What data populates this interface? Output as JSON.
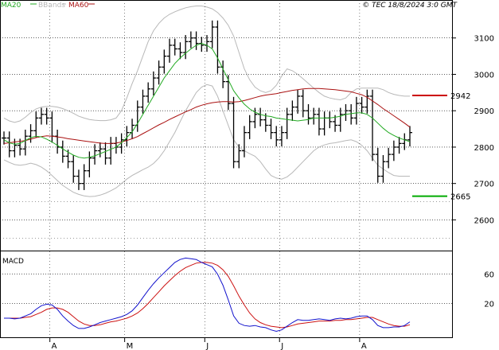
{
  "legend": {
    "ma20": "MA20",
    "bbands": "BBands",
    "ma60": "MA60"
  },
  "copyright": "© TEC 18/8/2024 3:0 GMT",
  "macd_label": "MACD",
  "colors": {
    "ma20": "#22aa22",
    "ma60": "#aa1111",
    "bbands": "#b8b8b8",
    "price": "#000000",
    "macd": "#1111cc",
    "signal": "#cc1111",
    "grid": "#000000",
    "level_high": "#cc0000",
    "level_low": "#00aa00"
  },
  "chart_data": [
    {
      "type": "line",
      "title": "",
      "ylim": [
        2520,
        3200
      ],
      "y_ticks": [
        {
          "value": 3100,
          "label": "3100"
        },
        {
          "value": 3000,
          "label": "3000"
        },
        {
          "value": 2900,
          "label": "2900"
        },
        {
          "value": 2800,
          "label": "2800"
        },
        {
          "value": 2700,
          "label": "2700"
        },
        {
          "value": 2600,
          "label": "2600"
        }
      ],
      "x_ticks": [
        "A",
        "M",
        "J",
        "J",
        "A"
      ],
      "levels": [
        {
          "name": "resistance",
          "value": 2942,
          "label": "2942"
        },
        {
          "name": "support",
          "value": 2665,
          "label": "2665"
        }
      ],
      "series": [
        {
          "name": "price",
          "values": [
            2825,
            2790,
            2805,
            2795,
            2830,
            2845,
            2880,
            2890,
            2880,
            2830,
            2800,
            2775,
            2760,
            2720,
            2700,
            2735,
            2770,
            2790,
            2795,
            2770,
            2810,
            2800,
            2820,
            2840,
            2860,
            2910,
            2940,
            2960,
            2990,
            3020,
            3050,
            3080,
            3070,
            3060,
            3090,
            3100,
            3085,
            3080,
            3090,
            3130,
            3020,
            2980,
            2920,
            2760,
            2790,
            2840,
            2870,
            2890,
            2875,
            2860,
            2840,
            2820,
            2840,
            2890,
            2910,
            2940,
            2900,
            2880,
            2890,
            2850,
            2880,
            2870,
            2860,
            2890,
            2900,
            2880,
            2920,
            2910,
            2940,
            2780,
            2720,
            2760,
            2780,
            2800,
            2810,
            2820,
            2840
          ]
        },
        {
          "name": "MA20",
          "values": [
            2820,
            2812,
            2808,
            2810,
            2818,
            2826,
            2830,
            2828,
            2822,
            2814,
            2805,
            2795,
            2786,
            2778,
            2772,
            2770,
            2772,
            2776,
            2782,
            2788,
            2794,
            2800,
            2812,
            2826,
            2842,
            2865,
            2890,
            2915,
            2940,
            2965,
            2990,
            3010,
            3030,
            3045,
            3058,
            3070,
            3080,
            3085,
            3080,
            3070,
            3045,
            3015,
            2985,
            2955,
            2935,
            2918,
            2905,
            2896,
            2890,
            2886,
            2884,
            2880,
            2878,
            2876,
            2874,
            2872,
            2874,
            2876,
            2880,
            2880,
            2880,
            2880,
            2882,
            2885,
            2890,
            2892,
            2894,
            2894,
            2890,
            2880,
            2866,
            2852,
            2840,
            2832,
            2825,
            2820,
            2815
          ]
        },
        {
          "name": "MA60",
          "values": [
            2810,
            2812,
            2814,
            2816,
            2818,
            2822,
            2826,
            2829,
            2831,
            2830,
            2828,
            2826,
            2823,
            2821,
            2819,
            2817,
            2815,
            2813,
            2811,
            2810,
            2810,
            2811,
            2814,
            2818,
            2823,
            2829,
            2837,
            2845,
            2853,
            2861,
            2868,
            2876,
            2883,
            2890,
            2897,
            2903,
            2910,
            2915,
            2919,
            2922,
            2924,
            2925,
            2925,
            2924,
            2925,
            2928,
            2932,
            2936,
            2940,
            2943,
            2945,
            2947,
            2950,
            2953,
            2956,
            2958,
            2960,
            2961,
            2961,
            2961,
            2960,
            2959,
            2958,
            2956,
            2954,
            2952,
            2948,
            2944,
            2937,
            2927,
            2917,
            2906,
            2896,
            2886,
            2876,
            2866,
            2855
          ]
        },
        {
          "name": "BBand upper",
          "values": [
            2880,
            2872,
            2868,
            2872,
            2882,
            2895,
            2905,
            2910,
            2912,
            2912,
            2910,
            2906,
            2900,
            2893,
            2885,
            2880,
            2876,
            2874,
            2873,
            2873,
            2875,
            2880,
            2900,
            2935,
            2975,
            3010,
            3050,
            3090,
            3120,
            3140,
            3155,
            3165,
            3172,
            3178,
            3183,
            3186,
            3188,
            3188,
            3185,
            3180,
            3170,
            3155,
            3135,
            3105,
            3060,
            3015,
            2985,
            2965,
            2955,
            2950,
            2955,
            2970,
            2995,
            3015,
            3010,
            3000,
            2988,
            2975,
            2962,
            2950,
            2940,
            2935,
            2932,
            2930,
            2935,
            2950,
            2960,
            2962,
            2962,
            2962,
            2962,
            2958,
            2950,
            2945,
            2942,
            2940,
            2940
          ]
        },
        {
          "name": "BBand lower",
          "values": [
            2765,
            2758,
            2752,
            2750,
            2752,
            2756,
            2752,
            2745,
            2735,
            2722,
            2708,
            2695,
            2685,
            2676,
            2670,
            2666,
            2664,
            2665,
            2668,
            2673,
            2680,
            2688,
            2700,
            2712,
            2722,
            2730,
            2738,
            2745,
            2755,
            2770,
            2790,
            2815,
            2840,
            2870,
            2900,
            2925,
            2950,
            2965,
            2972,
            2968,
            2940,
            2900,
            2860,
            2820,
            2800,
            2790,
            2782,
            2775,
            2760,
            2740,
            2722,
            2715,
            2712,
            2718,
            2730,
            2745,
            2760,
            2775,
            2790,
            2800,
            2806,
            2810,
            2812,
            2815,
            2818,
            2820,
            2815,
            2805,
            2790,
            2770,
            2750,
            2740,
            2730,
            2722,
            2720,
            2720,
            2720
          ]
        }
      ]
    },
    {
      "type": "line",
      "title": "MACD",
      "ylim": [
        -25,
        90
      ],
      "y_ticks": [
        {
          "value": 60,
          "label": "60"
        },
        {
          "value": 20,
          "label": "20"
        }
      ],
      "series": [
        {
          "name": "MACD",
          "values": [
            0,
            0,
            -1,
            0,
            3,
            6,
            12,
            17,
            19,
            18,
            12,
            3,
            -4,
            -10,
            -14,
            -14,
            -12,
            -9,
            -6,
            -4,
            -2,
            0,
            2,
            5,
            10,
            18,
            28,
            38,
            47,
            55,
            62,
            69,
            76,
            80,
            82,
            81,
            80,
            76,
            73,
            70,
            60,
            45,
            25,
            3,
            -7,
            -10,
            -11,
            -10,
            -12,
            -13,
            -16,
            -18,
            -16,
            -11,
            -6,
            -2,
            -3,
            -3,
            -2,
            -1,
            -2,
            -3,
            -1,
            0,
            -1,
            0,
            2,
            3,
            3,
            -2,
            -10,
            -13,
            -13,
            -12,
            -12,
            -10,
            -5
          ]
        },
        {
          "name": "Signal",
          "values": [
            0,
            0,
            0,
            0,
            1,
            2,
            5,
            8,
            12,
            14,
            14,
            12,
            8,
            2,
            -4,
            -8,
            -10,
            -10,
            -9,
            -7,
            -5,
            -4,
            -2,
            0,
            3,
            7,
            13,
            20,
            28,
            36,
            44,
            51,
            58,
            64,
            69,
            72,
            75,
            76,
            76,
            75,
            72,
            66,
            57,
            44,
            30,
            18,
            7,
            -1,
            -6,
            -9,
            -11,
            -12,
            -13,
            -12,
            -10,
            -8,
            -7,
            -6,
            -5,
            -4,
            -4,
            -4,
            -3,
            -3,
            -2,
            -2,
            -1,
            0,
            1,
            1,
            -2,
            -5,
            -8,
            -10,
            -11,
            -11,
            -9
          ]
        }
      ]
    }
  ]
}
